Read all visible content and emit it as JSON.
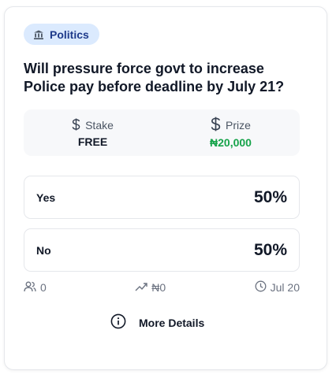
{
  "badge": {
    "label": "Politics",
    "icon": "bank-icon"
  },
  "question": "Will pressure force govt to increase Police pay before deadline by July 21?",
  "stats": {
    "stake": {
      "label": "Stake",
      "value": "FREE",
      "icon": "dollar-icon"
    },
    "prize": {
      "label": "Prize",
      "value": "₦20,000",
      "icon": "dollar-icon",
      "value_color": "#16a34a"
    }
  },
  "options": [
    {
      "label": "Yes",
      "percent": "50%"
    },
    {
      "label": "No",
      "percent": "50%"
    }
  ],
  "footer": {
    "participants": {
      "value": "0",
      "icon": "users-icon"
    },
    "volume": {
      "value": "₦0",
      "icon": "trending-up-icon"
    },
    "deadline": {
      "value": "Jul 20",
      "icon": "clock-icon"
    }
  },
  "details_button": {
    "label": "More Details",
    "icon": "info-icon"
  },
  "colors": {
    "badge_bg": "#dbeafe",
    "badge_text": "#1e3a8a",
    "prize_green": "#16a34a"
  }
}
